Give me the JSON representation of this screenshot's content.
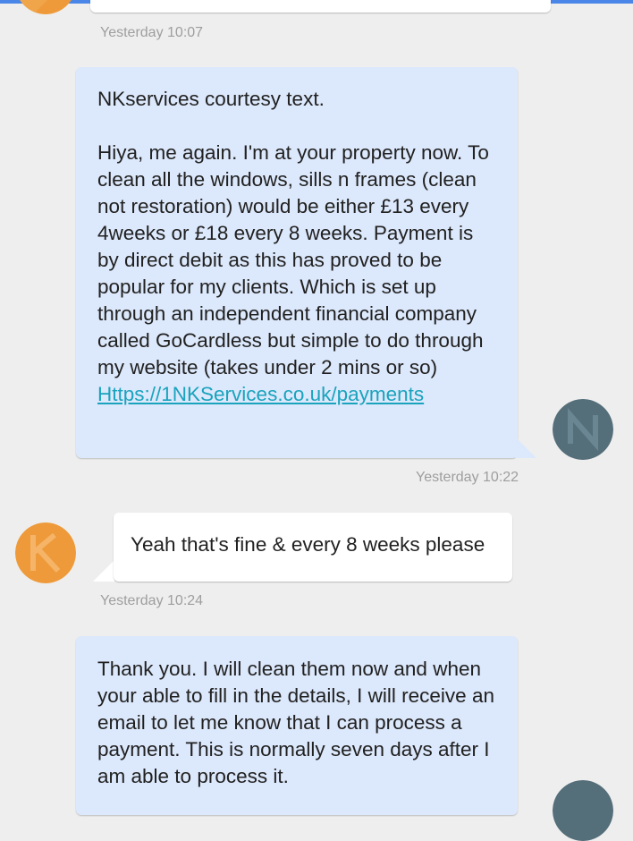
{
  "messages": [
    {
      "direction": "incoming",
      "text": "",
      "timestamp": "Yesterday 10:07"
    },
    {
      "direction": "outgoing",
      "lines": [
        "NKservices courtesy text.",
        "",
        "Hiya, me again. I'm at your property now. To clean all the windows, sills n frames (clean not restoration) would be either £13 every 4weeks or £18 every 8 weeks. Payment is by direct debit as this has proved to be popular for my clients. Which is set up through an independent financial company called GoCardless but simple to do through my website (takes under 2 mins or so)"
      ],
      "link": "Https://1NKServices.co.uk/payments",
      "timestamp": "Yesterday 10:22"
    },
    {
      "direction": "incoming",
      "text": "Yeah that's fine & every 8 weeks please",
      "timestamp": "Yesterday 10:24"
    },
    {
      "direction": "outgoing",
      "text": "Thank you. I will clean them now and when your able to fill in the details, I will receive an email to let me know that I can process a payment. This is normally seven days after I am able to process it."
    }
  ],
  "colors": {
    "background": "#eeeeee",
    "outgoing_bubble": "#dce8fb",
    "incoming_bubble": "#ffffff",
    "link": "#1aa3bd",
    "timestamp": "#9e9e9e",
    "contact_avatar": "#ee9a3a",
    "self_avatar": "#546e7a",
    "top_accent": "#4a86e8"
  },
  "icons": {
    "contact_avatar": "orange-contact-avatar-icon",
    "self_avatar": "gray-self-avatar-icon"
  }
}
